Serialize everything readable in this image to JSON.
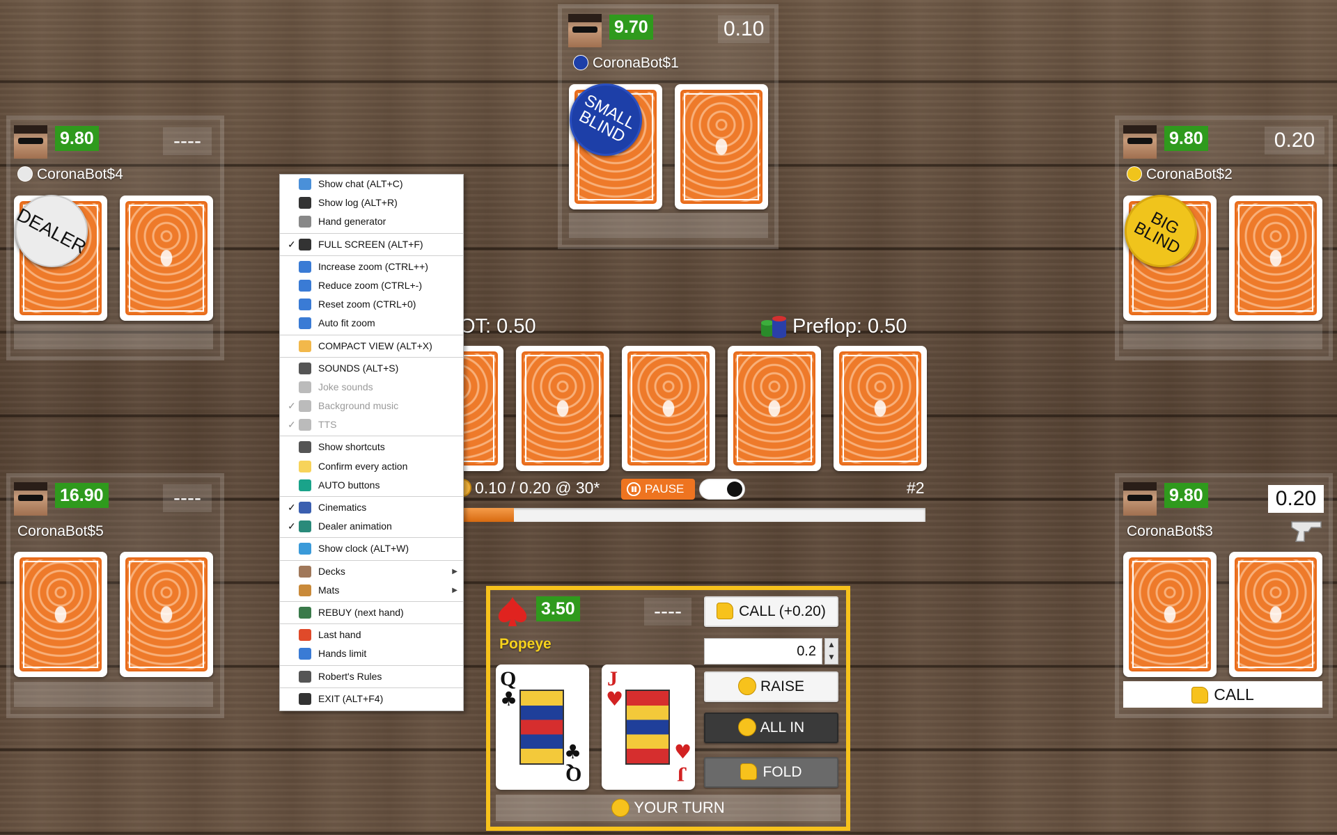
{
  "players": {
    "top": {
      "name": "CoronaBot$1",
      "stack": "9.70",
      "bet": "0.10",
      "marker": "SMALL BLIND"
    },
    "left_top": {
      "name": "CoronaBot$4",
      "stack": "9.80",
      "bet": "----",
      "marker": "DEALER"
    },
    "right_top": {
      "name": "CoronaBot$2",
      "stack": "9.80",
      "bet": "0.20",
      "marker": "BIG BLIND"
    },
    "left_bottom": {
      "name": "CoronaBot$5",
      "stack": "16.90",
      "bet": "----"
    },
    "right_bottom": {
      "name": "CoronaBot$3",
      "stack": "9.80",
      "bet": "0.20",
      "action": "CALL"
    }
  },
  "table": {
    "pot": "OT: 0.50",
    "street": "Preflop: 0.50",
    "blinds": "0.10 / 0.20 @ 30*",
    "pause": "PAUSE",
    "hand_number": "#2",
    "timer_progress": 0.11
  },
  "me": {
    "name": "Popeye",
    "stack": "3.50",
    "bet": "----",
    "cards": [
      {
        "rank": "Q",
        "suit": "♣",
        "color": "#111111"
      },
      {
        "rank": "J",
        "suit": "♥",
        "color": "#d22222"
      }
    ],
    "status": "YOUR TURN"
  },
  "actions": {
    "call": "CALL (+0.20)",
    "raise_amount": "0.2",
    "raise": "RAISE",
    "allin": "ALL IN",
    "fold": "FOLD"
  },
  "menu": {
    "groups": [
      [
        {
          "label": "Show chat (ALT+C)",
          "icon": "chat-icon",
          "color": "#4a90d9"
        },
        {
          "label": "Show log (ALT+R)",
          "icon": "log-icon",
          "color": "#333333"
        },
        {
          "label": "Hand generator",
          "icon": "cards-icon",
          "color": "#888888"
        }
      ],
      [
        {
          "label": "FULL SCREEN (ALT+F)",
          "icon": "fullscreen-icon",
          "color": "#333333",
          "checked": true
        }
      ],
      [
        {
          "label": "Increase zoom (CTRL++)",
          "icon": "zoom-in-icon",
          "color": "#3a7bd5"
        },
        {
          "label": "Reduce zoom (CTRL+-)",
          "icon": "zoom-out-icon",
          "color": "#3a7bd5"
        },
        {
          "label": "Reset zoom (CTRL+0)",
          "icon": "zoom-reset-icon",
          "color": "#3a7bd5"
        },
        {
          "label": "Auto fit zoom",
          "icon": "zoom-fit-icon",
          "color": "#3a7bd5"
        }
      ],
      [
        {
          "label": "COMPACT VIEW (ALT+X)",
          "icon": "compact-icon",
          "color": "#f2b84b"
        }
      ],
      [
        {
          "label": "SOUNDS (ALT+S)",
          "icon": "mute-icon",
          "color": "#555555"
        },
        {
          "label": "Joke sounds",
          "icon": "joke-icon",
          "color": "#bbbbbb",
          "disabled": true
        },
        {
          "label": "Background music",
          "icon": "music-icon",
          "color": "#bbbbbb",
          "disabled": true,
          "checked": true
        },
        {
          "label": "TTS",
          "icon": "tts-icon",
          "color": "#bbbbbb",
          "disabled": true,
          "checked": true
        }
      ],
      [
        {
          "label": "Show shortcuts",
          "icon": "keyboard-icon",
          "color": "#555555"
        },
        {
          "label": "Confirm every action",
          "icon": "hand-icon",
          "color": "#f7d35a"
        },
        {
          "label": "AUTO buttons",
          "icon": "auto-icon",
          "color": "#1aa38a"
        }
      ],
      [
        {
          "label": "Cinematics",
          "icon": "film-icon",
          "color": "#3a5fb0",
          "checked": true
        },
        {
          "label": "Dealer animation",
          "icon": "dealer-icon",
          "color": "#2a8a7a",
          "checked": true
        }
      ],
      [
        {
          "label": "Show clock (ALT+W)",
          "icon": "clock-icon",
          "color": "#3a9ad9"
        }
      ],
      [
        {
          "label": "Decks",
          "icon": "deck-icon",
          "color": "#a0785a",
          "submenu": true
        },
        {
          "label": "Mats",
          "icon": "mat-icon",
          "color": "#c98a3a",
          "submenu": true
        }
      ],
      [
        {
          "label": "REBUY (next hand)",
          "icon": "rebuy-icon",
          "color": "#3a7a4a"
        }
      ],
      [
        {
          "label": "Last hand",
          "icon": "stop-hand-icon",
          "color": "#e04a2a"
        },
        {
          "label": "Hands limit",
          "icon": "stopwatch-icon",
          "color": "#3a7bd5"
        }
      ],
      [
        {
          "label": "Robert's Rules",
          "icon": "book-icon",
          "color": "#555555"
        }
      ],
      [
        {
          "label": "EXIT (ALT+F4)",
          "icon": "exit-icon",
          "color": "#333333"
        }
      ]
    ]
  },
  "colors": {
    "stack_green": "#2f9a1d",
    "card_orange": "#ee7a2a",
    "turn_yellow": "#f7c21c",
    "small_blind": "#1d3fa8",
    "big_blind": "#f0c41c"
  }
}
